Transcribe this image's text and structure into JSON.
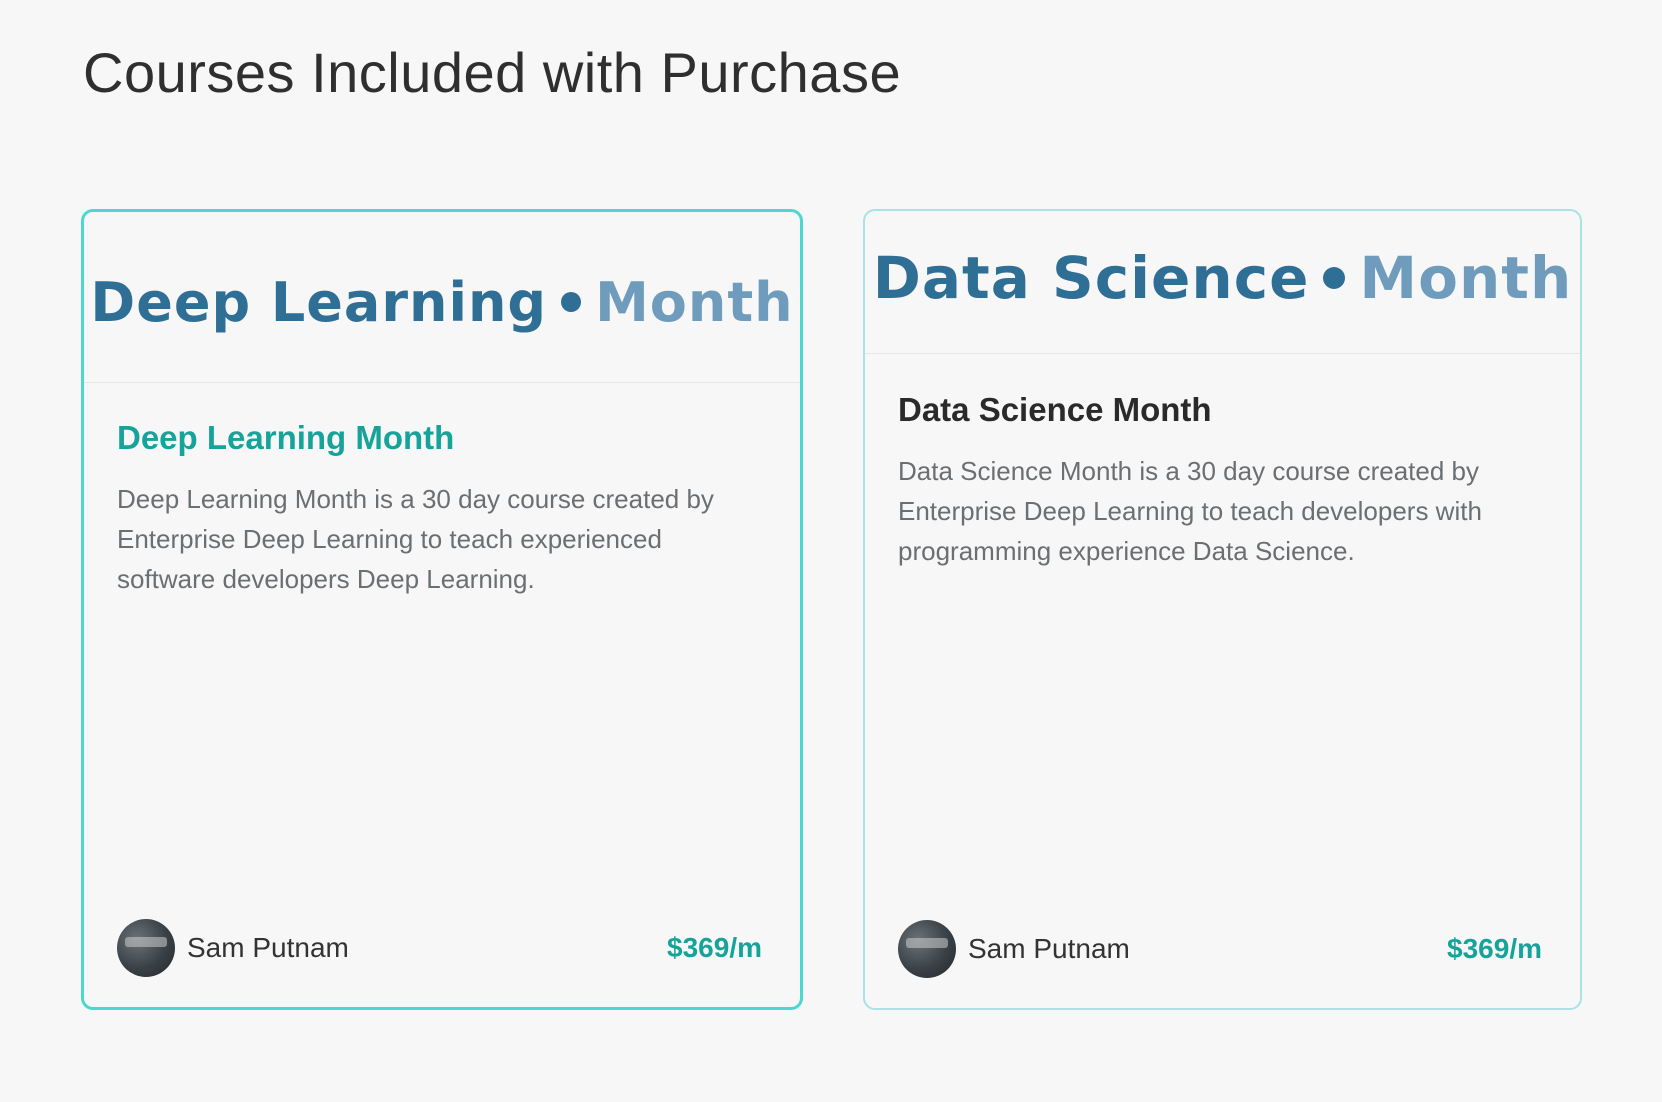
{
  "page": {
    "title": "Courses Included with Purchase"
  },
  "courses": [
    {
      "logo_primary": "Deep Learning",
      "logo_secondary": "Month",
      "title": "Deep Learning Month",
      "description": "Deep Learning Month is a 30 day course created by Enterprise Deep Learning to teach experienced software developers Deep Learning.",
      "author": "Sam Putnam",
      "price": "$369/m",
      "selected": true
    },
    {
      "logo_primary": "Data Science",
      "logo_secondary": "Month",
      "title": "Data Science Month",
      "description": "Data Science Month is a 30 day course created by Enterprise Deep Learning to teach developers with programming experience Data Science.",
      "author": "Sam Putnam",
      "price": "$369/m",
      "selected": false
    }
  ],
  "colors": {
    "accent": "#16a39a",
    "active_border": "#4ed6d0",
    "inactive_border": "#a9e3e3",
    "logo_dark": "#2f6f96",
    "logo_light": "#6f9cbc",
    "background": "#f7f7f7"
  }
}
